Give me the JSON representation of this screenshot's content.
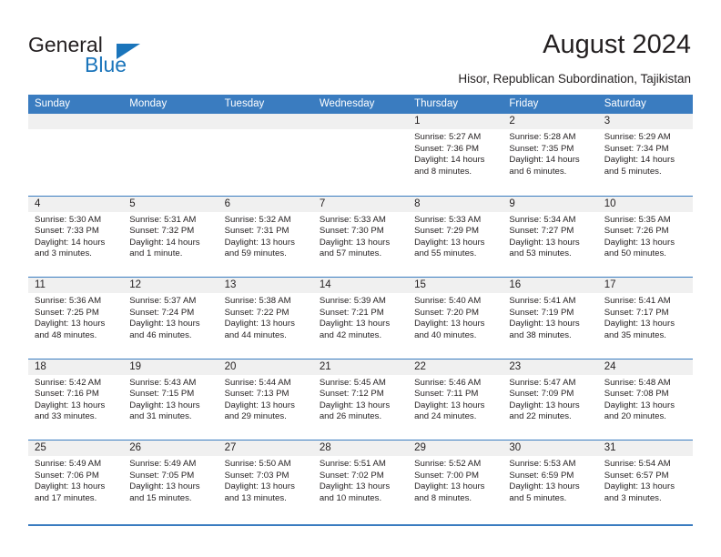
{
  "brand": {
    "name_part1": "General",
    "name_part2": "Blue",
    "accent_color": "#1b75bb"
  },
  "header": {
    "title": "August 2024",
    "subtitle": "Hisor, Republican Subordination, Tajikistan"
  },
  "calendar": {
    "header_color": "#3a7cc0",
    "weekdays": [
      "Sunday",
      "Monday",
      "Tuesday",
      "Wednesday",
      "Thursday",
      "Friday",
      "Saturday"
    ],
    "weeks": [
      [
        {
          "day": "",
          "sunrise": "",
          "sunset": "",
          "daylight_line1": "",
          "daylight_line2": "",
          "empty": true
        },
        {
          "day": "",
          "sunrise": "",
          "sunset": "",
          "daylight_line1": "",
          "daylight_line2": "",
          "empty": true
        },
        {
          "day": "",
          "sunrise": "",
          "sunset": "",
          "daylight_line1": "",
          "daylight_line2": "",
          "empty": true
        },
        {
          "day": "",
          "sunrise": "",
          "sunset": "",
          "daylight_line1": "",
          "daylight_line2": "",
          "empty": true
        },
        {
          "day": "1",
          "sunrise": "Sunrise: 5:27 AM",
          "sunset": "Sunset: 7:36 PM",
          "daylight_line1": "Daylight: 14 hours",
          "daylight_line2": "and 8 minutes."
        },
        {
          "day": "2",
          "sunrise": "Sunrise: 5:28 AM",
          "sunset": "Sunset: 7:35 PM",
          "daylight_line1": "Daylight: 14 hours",
          "daylight_line2": "and 6 minutes."
        },
        {
          "day": "3",
          "sunrise": "Sunrise: 5:29 AM",
          "sunset": "Sunset: 7:34 PM",
          "daylight_line1": "Daylight: 14 hours",
          "daylight_line2": "and 5 minutes."
        }
      ],
      [
        {
          "day": "4",
          "sunrise": "Sunrise: 5:30 AM",
          "sunset": "Sunset: 7:33 PM",
          "daylight_line1": "Daylight: 14 hours",
          "daylight_line2": "and 3 minutes."
        },
        {
          "day": "5",
          "sunrise": "Sunrise: 5:31 AM",
          "sunset": "Sunset: 7:32 PM",
          "daylight_line1": "Daylight: 14 hours",
          "daylight_line2": "and 1 minute."
        },
        {
          "day": "6",
          "sunrise": "Sunrise: 5:32 AM",
          "sunset": "Sunset: 7:31 PM",
          "daylight_line1": "Daylight: 13 hours",
          "daylight_line2": "and 59 minutes."
        },
        {
          "day": "7",
          "sunrise": "Sunrise: 5:33 AM",
          "sunset": "Sunset: 7:30 PM",
          "daylight_line1": "Daylight: 13 hours",
          "daylight_line2": "and 57 minutes."
        },
        {
          "day": "8",
          "sunrise": "Sunrise: 5:33 AM",
          "sunset": "Sunset: 7:29 PM",
          "daylight_line1": "Daylight: 13 hours",
          "daylight_line2": "and 55 minutes."
        },
        {
          "day": "9",
          "sunrise": "Sunrise: 5:34 AM",
          "sunset": "Sunset: 7:27 PM",
          "daylight_line1": "Daylight: 13 hours",
          "daylight_line2": "and 53 minutes."
        },
        {
          "day": "10",
          "sunrise": "Sunrise: 5:35 AM",
          "sunset": "Sunset: 7:26 PM",
          "daylight_line1": "Daylight: 13 hours",
          "daylight_line2": "and 50 minutes."
        }
      ],
      [
        {
          "day": "11",
          "sunrise": "Sunrise: 5:36 AM",
          "sunset": "Sunset: 7:25 PM",
          "daylight_line1": "Daylight: 13 hours",
          "daylight_line2": "and 48 minutes."
        },
        {
          "day": "12",
          "sunrise": "Sunrise: 5:37 AM",
          "sunset": "Sunset: 7:24 PM",
          "daylight_line1": "Daylight: 13 hours",
          "daylight_line2": "and 46 minutes."
        },
        {
          "day": "13",
          "sunrise": "Sunrise: 5:38 AM",
          "sunset": "Sunset: 7:22 PM",
          "daylight_line1": "Daylight: 13 hours",
          "daylight_line2": "and 44 minutes."
        },
        {
          "day": "14",
          "sunrise": "Sunrise: 5:39 AM",
          "sunset": "Sunset: 7:21 PM",
          "daylight_line1": "Daylight: 13 hours",
          "daylight_line2": "and 42 minutes."
        },
        {
          "day": "15",
          "sunrise": "Sunrise: 5:40 AM",
          "sunset": "Sunset: 7:20 PM",
          "daylight_line1": "Daylight: 13 hours",
          "daylight_line2": "and 40 minutes."
        },
        {
          "day": "16",
          "sunrise": "Sunrise: 5:41 AM",
          "sunset": "Sunset: 7:19 PM",
          "daylight_line1": "Daylight: 13 hours",
          "daylight_line2": "and 38 minutes."
        },
        {
          "day": "17",
          "sunrise": "Sunrise: 5:41 AM",
          "sunset": "Sunset: 7:17 PM",
          "daylight_line1": "Daylight: 13 hours",
          "daylight_line2": "and 35 minutes."
        }
      ],
      [
        {
          "day": "18",
          "sunrise": "Sunrise: 5:42 AM",
          "sunset": "Sunset: 7:16 PM",
          "daylight_line1": "Daylight: 13 hours",
          "daylight_line2": "and 33 minutes."
        },
        {
          "day": "19",
          "sunrise": "Sunrise: 5:43 AM",
          "sunset": "Sunset: 7:15 PM",
          "daylight_line1": "Daylight: 13 hours",
          "daylight_line2": "and 31 minutes."
        },
        {
          "day": "20",
          "sunrise": "Sunrise: 5:44 AM",
          "sunset": "Sunset: 7:13 PM",
          "daylight_line1": "Daylight: 13 hours",
          "daylight_line2": "and 29 minutes."
        },
        {
          "day": "21",
          "sunrise": "Sunrise: 5:45 AM",
          "sunset": "Sunset: 7:12 PM",
          "daylight_line1": "Daylight: 13 hours",
          "daylight_line2": "and 26 minutes."
        },
        {
          "day": "22",
          "sunrise": "Sunrise: 5:46 AM",
          "sunset": "Sunset: 7:11 PM",
          "daylight_line1": "Daylight: 13 hours",
          "daylight_line2": "and 24 minutes."
        },
        {
          "day": "23",
          "sunrise": "Sunrise: 5:47 AM",
          "sunset": "Sunset: 7:09 PM",
          "daylight_line1": "Daylight: 13 hours",
          "daylight_line2": "and 22 minutes."
        },
        {
          "day": "24",
          "sunrise": "Sunrise: 5:48 AM",
          "sunset": "Sunset: 7:08 PM",
          "daylight_line1": "Daylight: 13 hours",
          "daylight_line2": "and 20 minutes."
        }
      ],
      [
        {
          "day": "25",
          "sunrise": "Sunrise: 5:49 AM",
          "sunset": "Sunset: 7:06 PM",
          "daylight_line1": "Daylight: 13 hours",
          "daylight_line2": "and 17 minutes."
        },
        {
          "day": "26",
          "sunrise": "Sunrise: 5:49 AM",
          "sunset": "Sunset: 7:05 PM",
          "daylight_line1": "Daylight: 13 hours",
          "daylight_line2": "and 15 minutes."
        },
        {
          "day": "27",
          "sunrise": "Sunrise: 5:50 AM",
          "sunset": "Sunset: 7:03 PM",
          "daylight_line1": "Daylight: 13 hours",
          "daylight_line2": "and 13 minutes."
        },
        {
          "day": "28",
          "sunrise": "Sunrise: 5:51 AM",
          "sunset": "Sunset: 7:02 PM",
          "daylight_line1": "Daylight: 13 hours",
          "daylight_line2": "and 10 minutes."
        },
        {
          "day": "29",
          "sunrise": "Sunrise: 5:52 AM",
          "sunset": "Sunset: 7:00 PM",
          "daylight_line1": "Daylight: 13 hours",
          "daylight_line2": "and 8 minutes."
        },
        {
          "day": "30",
          "sunrise": "Sunrise: 5:53 AM",
          "sunset": "Sunset: 6:59 PM",
          "daylight_line1": "Daylight: 13 hours",
          "daylight_line2": "and 5 minutes."
        },
        {
          "day": "31",
          "sunrise": "Sunrise: 5:54 AM",
          "sunset": "Sunset: 6:57 PM",
          "daylight_line1": "Daylight: 13 hours",
          "daylight_line2": "and 3 minutes."
        }
      ]
    ]
  }
}
